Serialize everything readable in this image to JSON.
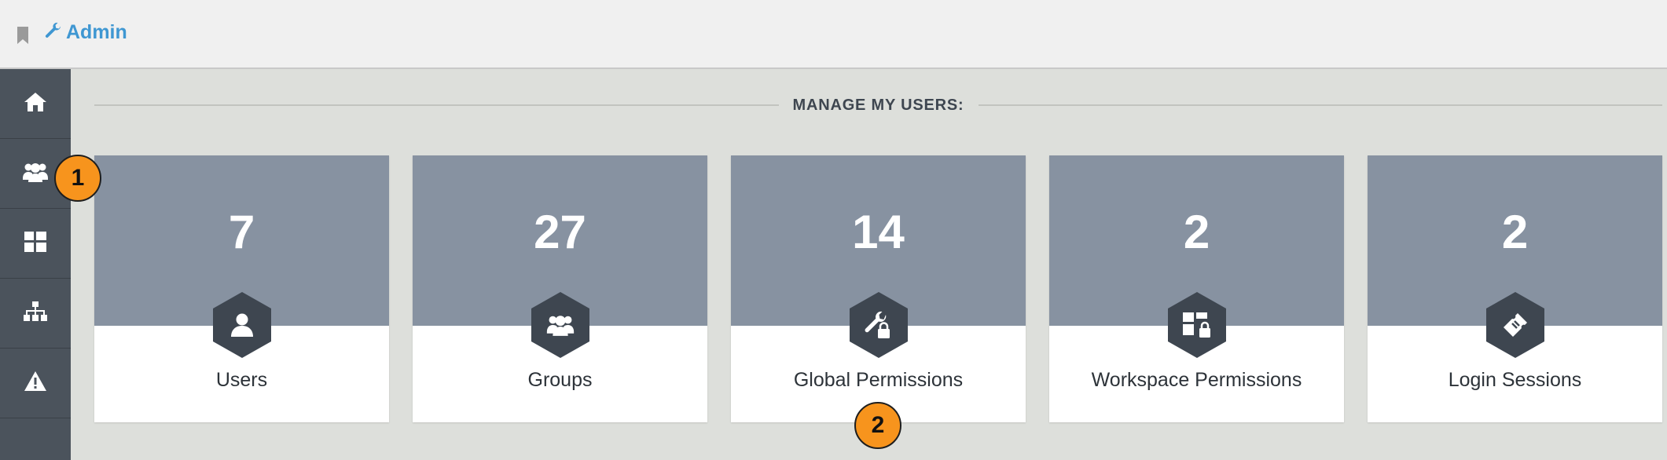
{
  "header": {
    "bookmark_icon": "bookmark-icon",
    "crumb_icon": "wrench-icon",
    "crumb_label": "Admin"
  },
  "sidebar": {
    "items": [
      {
        "icon": "home-icon"
      },
      {
        "icon": "users-icon"
      },
      {
        "icon": "dashboard-icon"
      },
      {
        "icon": "org-chart-icon"
      },
      {
        "icon": "warning-icon"
      }
    ]
  },
  "main": {
    "section_title": "MANAGE MY USERS:",
    "cards": [
      {
        "count": "7",
        "label": "Users",
        "icon": "user-icon"
      },
      {
        "count": "27",
        "label": "Groups",
        "icon": "group-icon"
      },
      {
        "count": "14",
        "label": "Global Permissions",
        "icon": "wrench-lock-icon"
      },
      {
        "count": "2",
        "label": "Workspace Permissions",
        "icon": "workspace-lock-icon"
      },
      {
        "count": "2",
        "label": "Login Sessions",
        "icon": "ticket-icon"
      }
    ]
  },
  "annotations": [
    "1",
    "2"
  ],
  "colors": {
    "accent": "#3f97d2",
    "sidebar": "#4b535c",
    "card_top": "#8792a1",
    "hex": "#3e4650",
    "badge": "#f7941d"
  }
}
